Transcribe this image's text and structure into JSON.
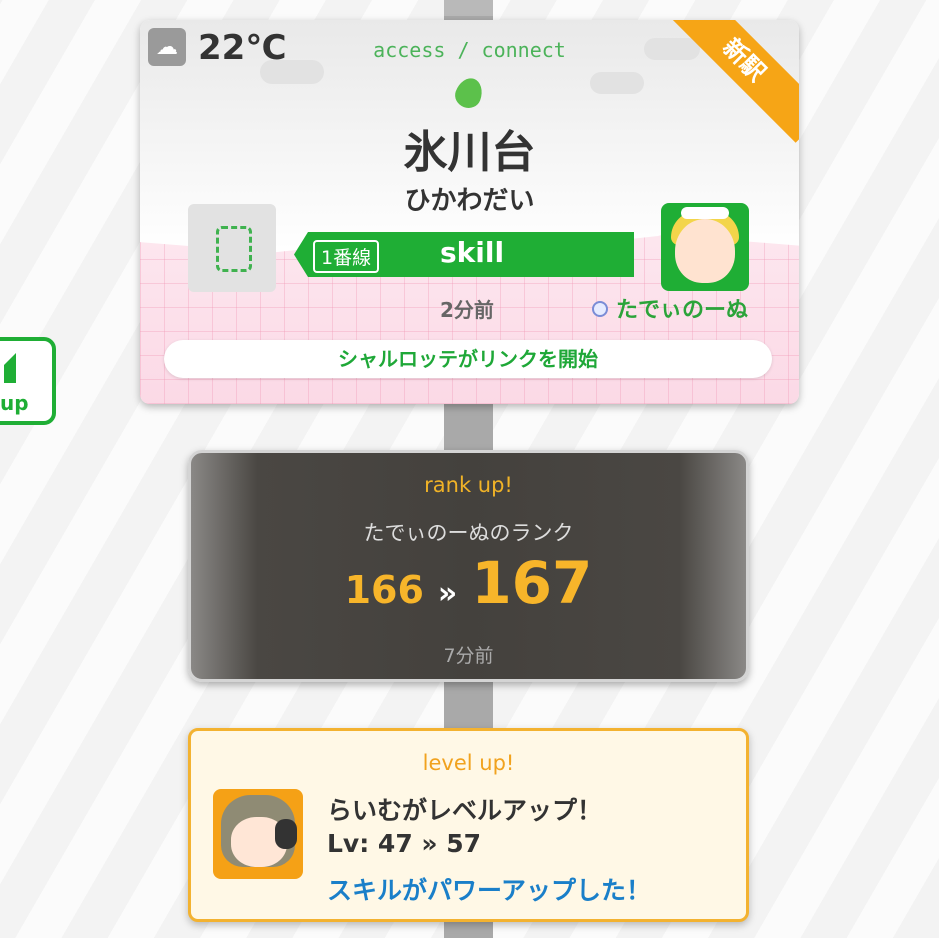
{
  "station_card": {
    "temperature": "22℃",
    "weather_icon": "cloud-icon",
    "tagline": "access / connect",
    "station_name": "氷川台",
    "station_kana": "ひかわだい",
    "new_badge": "新駅",
    "line_number": "1番線",
    "line_name": "skill",
    "time_ago": "2分前",
    "user_name": "たでぃのーぬ",
    "link_message": "シャルロッテがリンクを開始"
  },
  "side_button": {
    "label": "up"
  },
  "rank_card": {
    "title": "rank up!",
    "description": "たでぃのーぬのランク",
    "rank_from": "166",
    "rank_arrow": "»",
    "rank_to": "167",
    "time_ago": "7分前"
  },
  "level_card": {
    "title": "level up!",
    "message": "らいむがレベルアップ！",
    "level_line": "Lv: 47 » 57",
    "skill_message": "スキルがパワーアップした！"
  },
  "colors": {
    "line_green": "#1fae35",
    "rank_gold": "#f7b52a",
    "level_orange": "#f3b230",
    "skill_blue": "#1a7fc9"
  }
}
